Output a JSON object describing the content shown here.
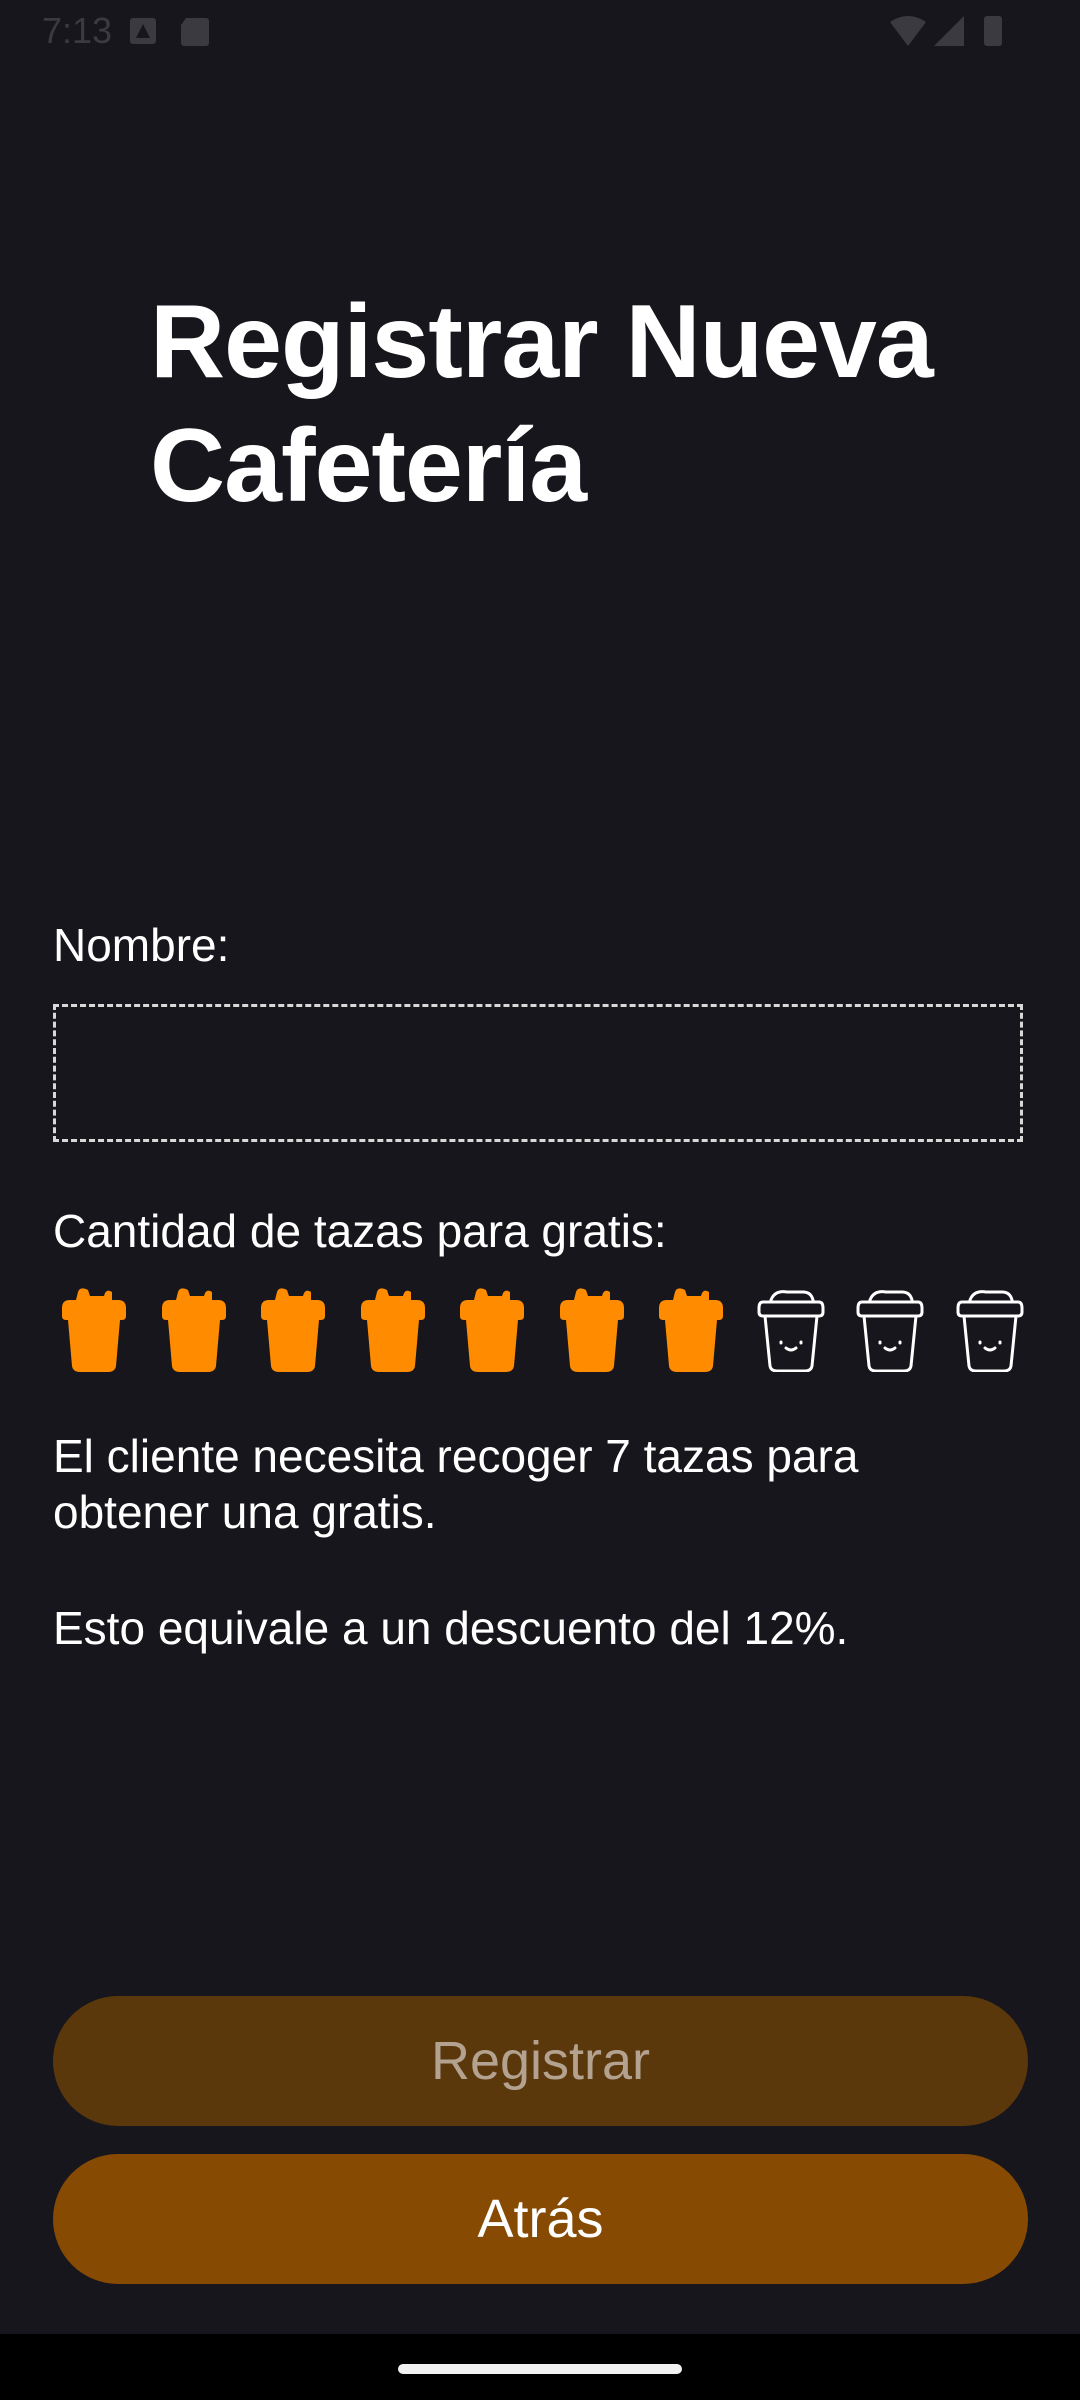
{
  "status_bar": {
    "time": "7:13"
  },
  "page": {
    "title": "Registrar Nueva\nCafetería"
  },
  "form": {
    "name_label": "Nombre:",
    "name_value": "",
    "cups_label": "Cantidad de tazas para gratis:",
    "cups_total": 10,
    "cups_selected": 7,
    "info_line_1": "El cliente necesita recoger 7 tazas para obtener una gratis.",
    "info_line_2": "Esto equivale a un descuento del 12%."
  },
  "buttons": {
    "register_label": "Registrar",
    "back_label": "Atrás"
  },
  "colors": {
    "background": "#16161c",
    "cup_filled": "#ff8c00",
    "cup_empty_outline": "#ffffff",
    "register_bg": "#5b370c",
    "back_bg": "#874a03"
  },
  "icons": {
    "cup_filled": "coffee-cup-filled-icon",
    "cup_empty": "coffee-cup-outline-icon"
  }
}
